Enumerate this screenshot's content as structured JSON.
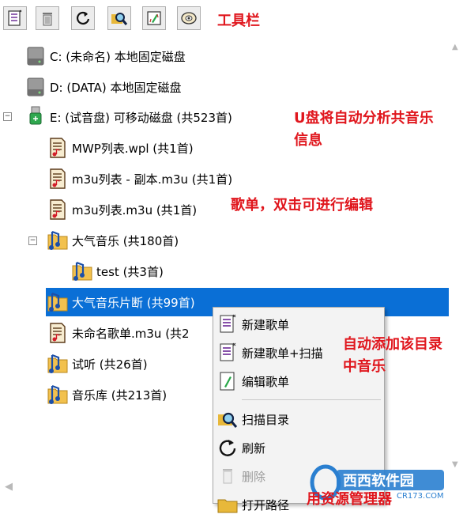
{
  "toolbar": {
    "buttons": [
      {
        "name": "new-playlist-icon"
      },
      {
        "name": "delete-icon"
      },
      {
        "name": "refresh-icon"
      },
      {
        "name": "scan-icon"
      },
      {
        "name": "edit-icon"
      },
      {
        "name": "about-icon"
      }
    ],
    "annotation": "工具栏"
  },
  "tree": {
    "items": [
      {
        "label": "C: (未命名) 本地固定磁盘",
        "icon": "hard-drive-icon"
      },
      {
        "label": "D: (DATA) 本地固定磁盘",
        "icon": "hard-drive-icon"
      },
      {
        "label": "E: (试音盘) 可移动磁盘 (共523首)",
        "icon": "usb-drive-icon",
        "expander": "⊟"
      },
      {
        "label": "MWP列表.wpl (共1首)",
        "icon": "playlist-file-icon"
      },
      {
        "label": "m3u列表 - 副本.m3u (共1首)",
        "icon": "playlist-file-icon"
      },
      {
        "label": "m3u列表.m3u (共1首)",
        "icon": "playlist-file-icon"
      },
      {
        "label": "大气音乐 (共180首)",
        "icon": "music-folder-icon",
        "expander": "⊟"
      },
      {
        "label": "test (共3首)",
        "icon": "music-folder-icon"
      },
      {
        "label": "大气音乐片断 (共99首)",
        "icon": "music-folder-icon",
        "selected": true
      },
      {
        "label": "未命名歌单.m3u (共2",
        "icon": "playlist-file-icon"
      },
      {
        "label": "试听 (共26首)",
        "icon": "music-folder-icon"
      },
      {
        "label": "音乐库 (共213首)",
        "icon": "music-folder-icon"
      }
    ],
    "annotations": {
      "usb": "U盘将自动分析共音乐信息",
      "playlist": "歌单，双击可进行编辑"
    }
  },
  "context_menu": {
    "items": [
      {
        "label": "新建歌单",
        "icon": "new-playlist-icon"
      },
      {
        "label": "新建歌单+扫描",
        "icon": "new-playlist-scan-icon"
      },
      {
        "label": "编辑歌单",
        "icon": "edit-playlist-icon"
      },
      {
        "label": "扫描目录",
        "icon": "scan-folder-icon"
      },
      {
        "label": "刷新",
        "icon": "refresh-icon"
      },
      {
        "label": "删除",
        "icon": "delete-icon",
        "disabled": true
      },
      {
        "label": "打开路径",
        "icon": "open-path-icon"
      }
    ],
    "annotations": {
      "scan": "自动添加该目录中音乐",
      "open": "用资源管理器"
    }
  },
  "watermark": {
    "brand": "西西软件园",
    "site": "CR173.COM"
  },
  "colors": {
    "annotation": "#e0161d",
    "selection": "#0a6fd6"
  }
}
